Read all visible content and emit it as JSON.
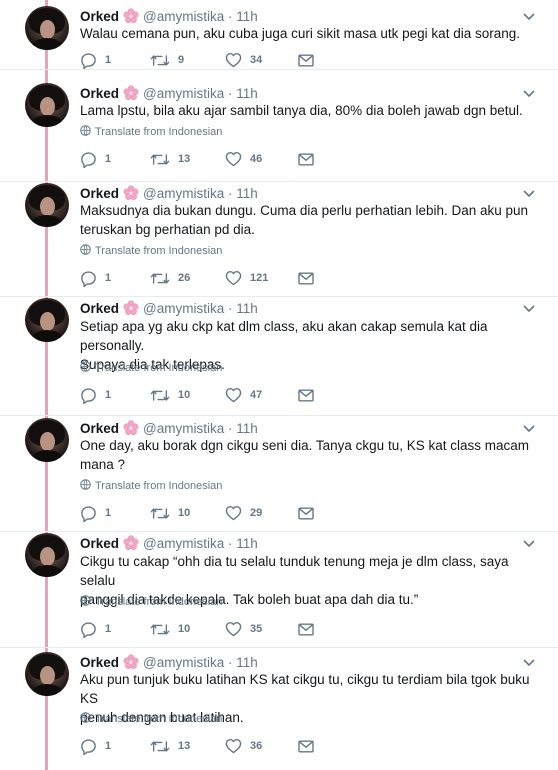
{
  "author": {
    "name": "Orked",
    "handle": "@amymistika",
    "separator": "·",
    "time": "11h"
  },
  "translate_label": "Translate from Indonesian",
  "icons": {
    "reply": "reply-icon",
    "retweet": "retweet-icon",
    "like": "heart-icon",
    "dm": "envelope-icon",
    "more": "chevron-down-icon",
    "emoji": "cherry-blossom-icon",
    "globe": "globe-icon"
  },
  "colors": {
    "thread_line": "#e5a3bd",
    "muted": "#657786",
    "text": "#14171a",
    "blossom": "#f4a6c6"
  },
  "tweets": [
    {
      "lines": [
        "Walau cemana pun, aku cuba juga curi sikit masa utk pegi kat dia sorang."
      ],
      "replies": "1",
      "retweets": "9",
      "likes": "34"
    },
    {
      "lines": [
        "Lama lpstu, bila aku ajar sambil tanya dia, 80% dia boleh jawab dgn betul."
      ],
      "replies": "1",
      "retweets": "13",
      "likes": "46"
    },
    {
      "lines": [
        "Maksudnya dia bukan dungu. Cuma dia perlu perhatian lebih. Dan aku pun",
        "teruskan bg perhatian pd dia."
      ],
      "replies": "1",
      "retweets": "26",
      "likes": "121"
    },
    {
      "lines": [
        "Setiap apa yg aku ckp kat dlm class, aku akan cakap semula kat dia personally.",
        "Supaya dia tak terlepas."
      ],
      "replies": "1",
      "retweets": "10",
      "likes": "47"
    },
    {
      "lines": [
        "One day, aku borak dgn cikgu seni dia. Tanya ckgu tu, KS kat class macam",
        "mana ?"
      ],
      "replies": "1",
      "retweets": "10",
      "likes": "29"
    },
    {
      "lines": [
        "Cikgu tu cakap “ohh dia tu selalu tunduk tenung meja je dlm class, saya selalu",
        "panggil dia takde kepala. Tak boleh buat apa dah dia tu.”"
      ],
      "replies": "1",
      "retweets": "10",
      "likes": "35"
    },
    {
      "lines": [
        "Aku pun tunjuk buku latihan KS kat cikgu tu, cikgu tu terdiam bila tgok buku KS",
        "penuh dengan buat latihan."
      ],
      "replies": "1",
      "retweets": "13",
      "likes": "36"
    }
  ]
}
